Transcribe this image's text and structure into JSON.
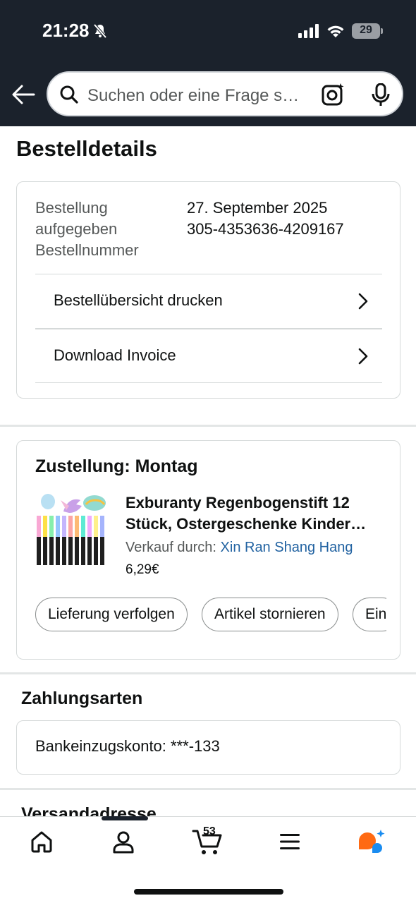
{
  "status_bar": {
    "time": "21:28",
    "battery": "29"
  },
  "search": {
    "placeholder": "Suchen oder eine Frage s…"
  },
  "page": {
    "title": "Bestelldetails"
  },
  "order_info": {
    "label_ordered": "Bestellung aufgegeben",
    "label_number": "Bestellnummer",
    "date": "27. September 2025",
    "number": "305-4353636-4209167",
    "print_label": "Bestellübersicht drucken",
    "invoice_label": "Download Invoice"
  },
  "delivery": {
    "title": "Zustellung: Montag",
    "product_title_line1": "Exburanty Regenbogenstift 12",
    "product_title_line2": "Stück, Ostergeschenke Kinder…",
    "seller_prefix": "Verkauf durch: ",
    "seller_name": "Xin Ran Shang Hang",
    "price": "6,29€",
    "actions": [
      "Lieferung verfolgen",
      "Artikel stornieren",
      "Ein"
    ]
  },
  "payment": {
    "title": "Zahlungsarten",
    "method": "Bankeinzugskonto: ***-133"
  },
  "shipping": {
    "title": "Versandadresse"
  },
  "bottom_nav": {
    "cart_count": "53",
    "items": [
      "home-icon",
      "account-icon",
      "cart-icon",
      "menu-icon",
      "rufus-icon"
    ]
  },
  "colors": {
    "header_bg": "#1b222c",
    "link": "#2162a1",
    "rufus_orange": "#ff6a13",
    "rufus_blue": "#1a8cf0"
  }
}
